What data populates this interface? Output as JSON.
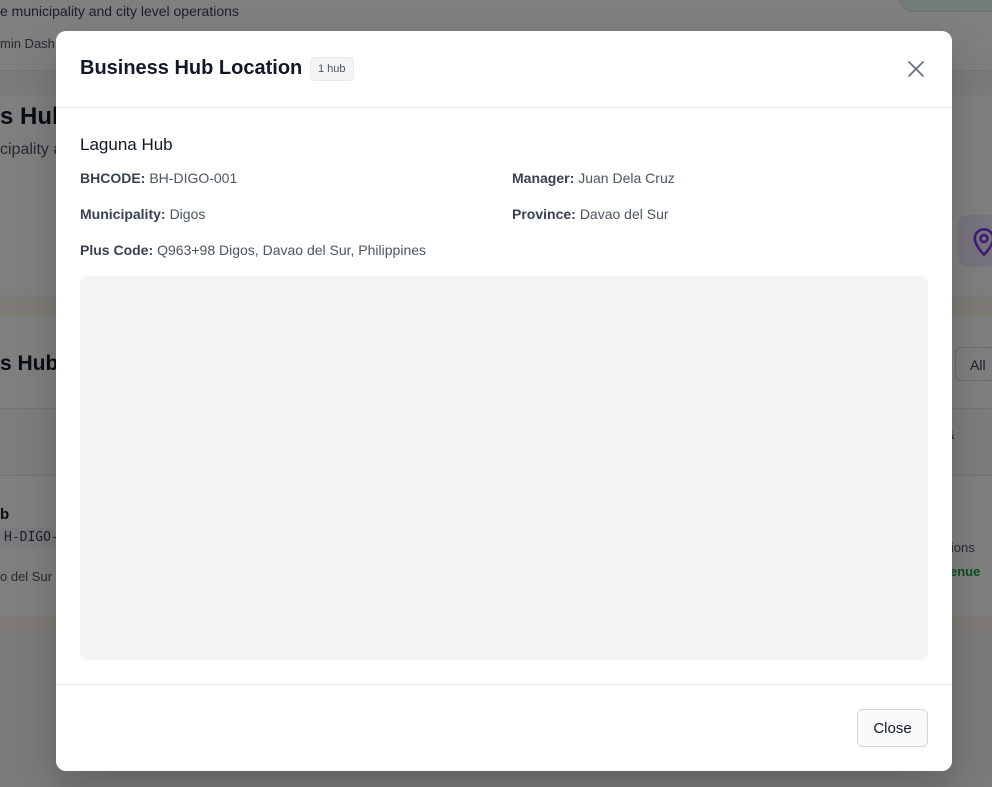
{
  "background": {
    "subtitle": "e municipality and city level operations",
    "breadcrumb": "min Dash",
    "hero_title": "s Hub",
    "hero_subtitle": "cipality a",
    "section_title": "s Hubs",
    "filter_label": "All",
    "table_header_glyph": "&",
    "row": {
      "name": "b",
      "code": "H-DIGO-",
      "province": "o del Sur",
      "operations": "ations",
      "revenue": "enue"
    },
    "icons": {
      "map_pin": "map-pin-icon"
    },
    "colors": {
      "pin_accent": "#7c3aed",
      "revenue_green": "#16a34a"
    }
  },
  "modal": {
    "title": "Business Hub Location",
    "badge": "1 hub",
    "close_icon": "close-icon",
    "hub": {
      "name": "Laguna Hub",
      "bhcode_label": "BHCODE:",
      "bhcode": "BH-DIGO-001",
      "manager_label": "Manager:",
      "manager": "Juan Dela Cruz",
      "municipality_label": "Municipality:",
      "municipality": "Digos",
      "province_label": "Province:",
      "province": "Davao del Sur",
      "plus_code_label": "Plus Code:",
      "plus_code": "Q963+98 Digos, Davao del Sur, Philippines"
    },
    "footer": {
      "close_label": "Close"
    }
  }
}
